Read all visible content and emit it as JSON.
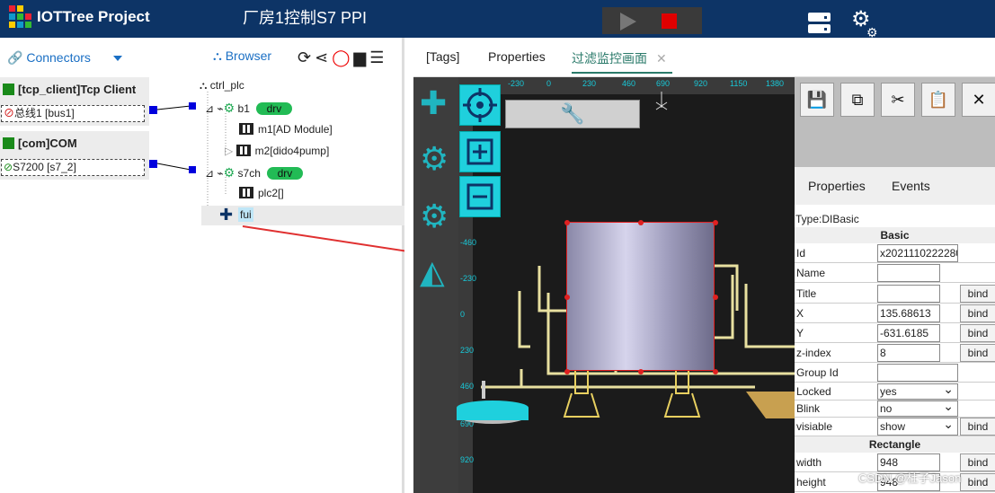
{
  "app": {
    "title": "IOTTree Project",
    "project_title": "厂房1控制S7 PPI"
  },
  "colors": {
    "topbar": "#0d3466",
    "accent": "#1a6fc4",
    "drv": "#22bb55",
    "stop": "#e00000",
    "editor_accent": "#1fd0dd"
  },
  "connectors": {
    "header": "Connectors",
    "groups": [
      {
        "title": "[tcp_client]Tcp Client",
        "item": "总线1 [bus1]"
      },
      {
        "title": "[com]COM",
        "item": "S7200 [s7_2]"
      }
    ]
  },
  "browser": {
    "header": "Browser",
    "tree": {
      "root": "ctrl_plc",
      "ch1": {
        "name": "b1",
        "badge": "drv",
        "children": [
          "m1[AD Module]",
          "m2[dido4pump]"
        ]
      },
      "ch2": {
        "name": "s7ch",
        "badge": "drv",
        "children": [
          "plc2[]"
        ]
      },
      "ui": "fui"
    }
  },
  "tabs": [
    "[Tags]",
    "Properties",
    "过滤监控画面"
  ],
  "ruler": {
    "top": [
      "-230",
      "0",
      "230",
      "460",
      "690",
      "920",
      "1150",
      "1380"
    ],
    "left": [
      "-460",
      "-230",
      "0",
      "230",
      "460",
      "690",
      "920"
    ]
  },
  "props_panel": {
    "tabs": [
      "Properties",
      "Events"
    ],
    "type": "Type:DIBasic",
    "sections": {
      "basic": "Basic",
      "rect": "Rectangle"
    },
    "bind_label": "bind",
    "rows": [
      {
        "key": "Id",
        "value": "x2021110222280"
      },
      {
        "key": "Name",
        "value": ""
      },
      {
        "key": "Title",
        "value": ""
      },
      {
        "key": "X",
        "value": "135.68613"
      },
      {
        "key": "Y",
        "value": "-631.6185"
      },
      {
        "key": "z-index",
        "value": "8"
      },
      {
        "key": "Group Id",
        "value": ""
      },
      {
        "key": "Locked",
        "value": "yes"
      },
      {
        "key": "Blink",
        "value": "no"
      },
      {
        "key": "visiable",
        "value": "show"
      },
      {
        "key": "width",
        "value": "948"
      },
      {
        "key": "height",
        "value": "948"
      }
    ]
  },
  "watermark": "CSDN @杜子Jason"
}
